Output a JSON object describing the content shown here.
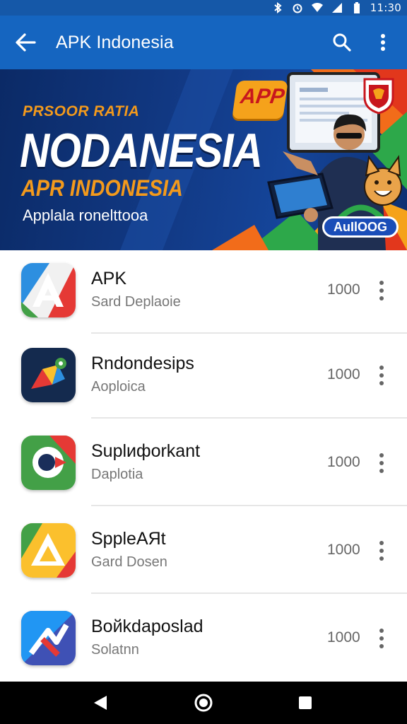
{
  "status_bar": {
    "time": "11:30",
    "icons": [
      "bluetooth-icon",
      "alarm-icon",
      "wifi-icon",
      "signal-icon",
      "battery-icon"
    ]
  },
  "app_bar": {
    "title": "APK Indonesia",
    "icons": [
      "back-arrow-icon",
      "search-icon",
      "more-vert-icon"
    ]
  },
  "banner": {
    "subheading": "PRSOOR RATIA",
    "headline": "NODANESIA",
    "tagline": "APR INDONESIA",
    "caption": "Applala ronelttooa",
    "badge": "APP",
    "pill": "AuIlOOG"
  },
  "apps": [
    {
      "name": "APK",
      "subtitle": "Sard Deplaoie",
      "count": "1000",
      "icon": "apk-app-icon"
    },
    {
      "name": "Rndondesiрs",
      "subtitle": "Aoploica",
      "count": "1000",
      "icon": "rndondesirs-app-icon"
    },
    {
      "name": "Suplифorkant",
      "subtitle": "Daplotia",
      "count": "1000",
      "icon": "suplrforkant-app-icon"
    },
    {
      "name": "SppleAЯt",
      "subtitle": "Gard Dosen",
      "count": "1000",
      "icon": "sppleart-app-icon"
    },
    {
      "name": "Boйkdaposlad",
      "subtitle": "Solatnn",
      "count": "1000",
      "icon": "boikdaposlad-app-icon"
    }
  ],
  "nav_bar": {
    "icons": [
      "nav-back-icon",
      "nav-home-icon",
      "nav-recents-icon"
    ]
  },
  "colors": {
    "app_bar": "#1565c0",
    "status_bar": "#1558a8",
    "accent_orange": "#f39a1c"
  }
}
